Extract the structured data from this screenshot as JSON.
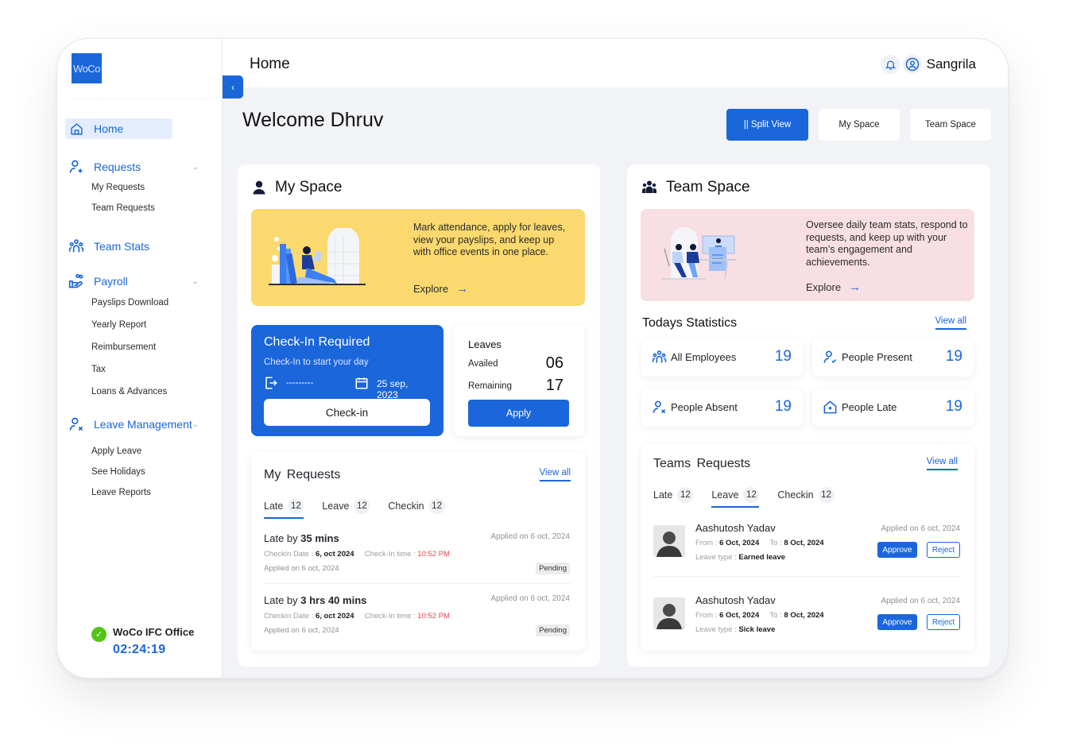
{
  "app": {
    "logo_text": "WoCo"
  },
  "sidebar": {
    "home": "Home",
    "groups": [
      {
        "label": "Requests",
        "icon": "user-plus-icon",
        "items": [
          "My Requests",
          "Team Requests"
        ]
      },
      {
        "label": "Team Stats",
        "icon": "team-icon",
        "items": []
      },
      {
        "label": "Payroll",
        "icon": "hand-coins-icon",
        "items": [
          "Payslips Download",
          "Yearly Report",
          "Reimbursement",
          "Tax",
          "Loans & Advances"
        ]
      },
      {
        "label": "Leave Management",
        "icon": "user-x-icon",
        "items": [
          "Apply Leave",
          "See Holidays",
          "Leave Reports"
        ]
      }
    ],
    "office": {
      "name": "WoCo IFC Office",
      "timer": "02:24:19",
      "status_color": "#52c41a"
    }
  },
  "header": {
    "title": "Home",
    "user_name": "Sangrila"
  },
  "welcome": "Welcome Dhruv",
  "view_buttons": [
    "|| Split View",
    "My Space",
    "Team Space"
  ],
  "my_space": {
    "title": "My Space",
    "banner": {
      "text": "Mark attendance, apply for leaves, view your payslips, and keep up with office events in one place.",
      "explore": "Explore",
      "color": "#fcd96e"
    },
    "checkin": {
      "title": "Check-In Required",
      "subtitle": "Check-In to start your day",
      "checkin_time": "---------",
      "date": "25 sep, 2023",
      "button": "Check-in"
    },
    "leaves": {
      "title": "Leaves",
      "availed_label": "Availed",
      "availed": "06",
      "remaining_label": "Remaining",
      "remaining": "17",
      "button": "Apply"
    },
    "requests": {
      "title": "My  Requests",
      "view_all": "View all",
      "tabs": [
        {
          "label": "Late",
          "count": "12"
        },
        {
          "label": "Leave",
          "count": "12"
        },
        {
          "label": "Checkin",
          "count": "12"
        }
      ],
      "items": [
        {
          "prefix": "Late by ",
          "duration": "35 mins",
          "applied_right": "Applied on 6 oct, 2024",
          "date_label": "Checkin Date : ",
          "date": "6, oct 2024",
          "time_label": "Check-In time : ",
          "time": "10:52 PM",
          "applied": "Applied on 6 oct, 2024",
          "status": "Pending"
        },
        {
          "prefix": "Late by ",
          "duration": "3 hrs 40 mins",
          "applied_right": "Applied on 6 oct, 2024",
          "date_label": "Checkin Date : ",
          "date": "6, oct 2024",
          "time_label": "Check-In time : ",
          "time": "10:52 PM",
          "applied": "Applied on 6 oct, 2024",
          "status": "Pending"
        }
      ]
    }
  },
  "team_space": {
    "title": "Team Space",
    "banner": {
      "text": "Oversee daily team stats, respond to requests, and keep up with your team’s engagement and achievements.",
      "explore": "Explore",
      "color": "#f8dfe4"
    },
    "stats": {
      "title": "Todays Statistics",
      "view_all": "View all",
      "items": [
        {
          "label": "All Employees",
          "value": "19"
        },
        {
          "label": "People Present",
          "value": "19"
        },
        {
          "label": "People Absent",
          "value": "19"
        },
        {
          "label": "People Late",
          "value": "19"
        }
      ]
    },
    "requests": {
      "title": "Teams  Requests",
      "view_all": "View all",
      "tabs": [
        {
          "label": "Late",
          "count": "12"
        },
        {
          "label": "Leave",
          "count": "12"
        },
        {
          "label": "Checkin",
          "count": "12"
        }
      ],
      "items": [
        {
          "name": "Aashutosh Yadav",
          "from_label": "From : ",
          "from": "6 Oct, 2024",
          "to_label": "To : ",
          "to": "8 Oct, 2024",
          "type_label": "Leave type : ",
          "type": "Earned leave",
          "applied": "Applied on 6 oct, 2024",
          "approve": "Approve",
          "reject": "Reject"
        },
        {
          "name": "Aashutosh Yadav",
          "from_label": "From : ",
          "from": "6 Oct, 2024",
          "to_label": "To : ",
          "to": "8 Oct, 2024",
          "type_label": "Leave type : ",
          "type": "Sick leave",
          "applied": "Applied on 6 oct, 2024",
          "approve": "Approve",
          "reject": "Reject"
        }
      ]
    }
  }
}
